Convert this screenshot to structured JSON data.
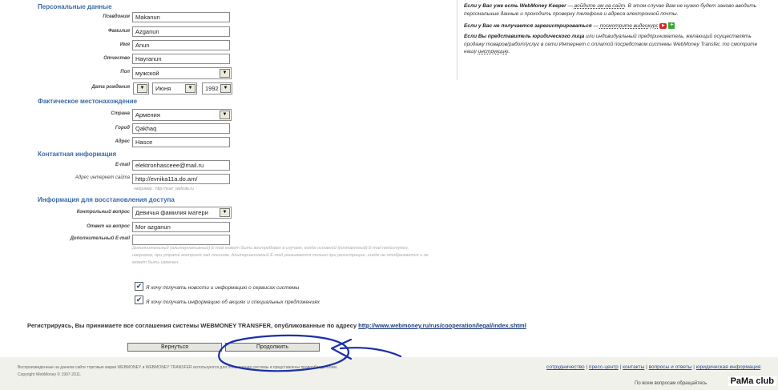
{
  "sections": {
    "personal": "Персональные данные",
    "location": "Фактическое местонахождение",
    "contact": "Контактная информация",
    "recovery": "Информация для восстановления доступа"
  },
  "fields": {
    "nickname": {
      "label": "Псевдоним",
      "value": "Makanun"
    },
    "surname": {
      "label": "Фамилия",
      "value": "Azganun"
    },
    "name": {
      "label": "Имя",
      "value": "Anun"
    },
    "patronymic": {
      "label": "Отчество",
      "value": "Hayranun"
    },
    "gender": {
      "label": "Пол",
      "value": "мужской"
    },
    "birthdate": {
      "label": "Дата рождения",
      "month": "Июня",
      "year": "1992"
    },
    "country": {
      "label": "Страна",
      "value": "Армения"
    },
    "city": {
      "label": "Город",
      "value": "Qakhaq"
    },
    "address": {
      "label": "Адрес",
      "value": "Hasce"
    },
    "email": {
      "label": "E-mail",
      "value": "elektronhasceee@mail.ru"
    },
    "website": {
      "label": "Адрес интернет сайта",
      "value": "http://evnika11a.do.am/",
      "hint": "например : http://your_website.ru"
    },
    "question": {
      "label": "Контрольный вопрос",
      "value": "Девичья фамилия матери"
    },
    "answer": {
      "label": "Ответ на вопрос",
      "value": "Mor azganun"
    },
    "extra_email": {
      "label": "Дополнительный E-mail",
      "value": ""
    }
  },
  "extra_email_note": "Дополнительный (альтернативный) E-mail может быть востребован в случаях, когда основной (контактный) E-mail недоступен, например, при утрате контроля над логином. Альтернативный E-mail указывается только при регистрации, нигде не отображается и не может быть изменен.",
  "checkboxes": {
    "news": {
      "label": "Я хочу получать новости и информацию о сервисах системы",
      "checked": true
    },
    "promo": {
      "label": "Я хочу получать информацию об акциях и специальных предложениях",
      "checked": true
    }
  },
  "agreement": {
    "text": "Регистрируясь, Вы принимаете все соглашения системы WEBMONEY TRANSFER, опубликованные по адресу",
    "link": "http://www.webmoney.ru/rus/cooperation/legal/index.shtml"
  },
  "buttons": {
    "back": "Вернуться",
    "continue": "Продолжить"
  },
  "right_panel": {
    "p1_bold": "Если у Вас уже есть WebMoney Keeper",
    "p1_dash": " — ",
    "p1_link": "войдите им на сайт",
    "p1_rest": ". В этом случае Вам не нужно будет заново вводить персональные данные и проходить проверку телефона и адреса электронной почты.",
    "p2_bold": "Если у Вас не получается зарегистрироваться",
    "p2_dash": " — ",
    "p2_link": "посмотрите видеокурс",
    "p3_bold": "Если Вы представитель юридического лица",
    "p3_rest": " или индивидуальный предприниматель, желающий осуществлять продажу товаров/работ/услуг в сети Интернет с оплатой посредством системы WebMoney Transfer, то смотрите нашу ",
    "p3_link": "инструкцию",
    "p3_end": "."
  },
  "footer": {
    "copy1": "Воспроизведенные на данном сайте торговые марки WEBMONEY и WEBMONEY TRANSFER используются для обозначения системы и представлены правообладателем.",
    "copy2": "Copyright WebMoney © 1997-2011.",
    "nav": [
      "сотрудничество",
      "пресс-центр",
      "контакты",
      "вопросы и ответы",
      "юридическая информация"
    ],
    "sep": "|",
    "support": "По всем вопросам обращайтесь"
  },
  "watermark": "PaMa club",
  "icons": {
    "dropdown": "chevron-down-icon",
    "check": "check-icon",
    "video": "youtube-icon",
    "plus": "plus-icon",
    "annotation": "hand-drawn-circle-arrow"
  },
  "colors": {
    "section_heading": "#3b6aa8",
    "link": "#1a3a7a",
    "annotation": "#1b2fa8"
  }
}
